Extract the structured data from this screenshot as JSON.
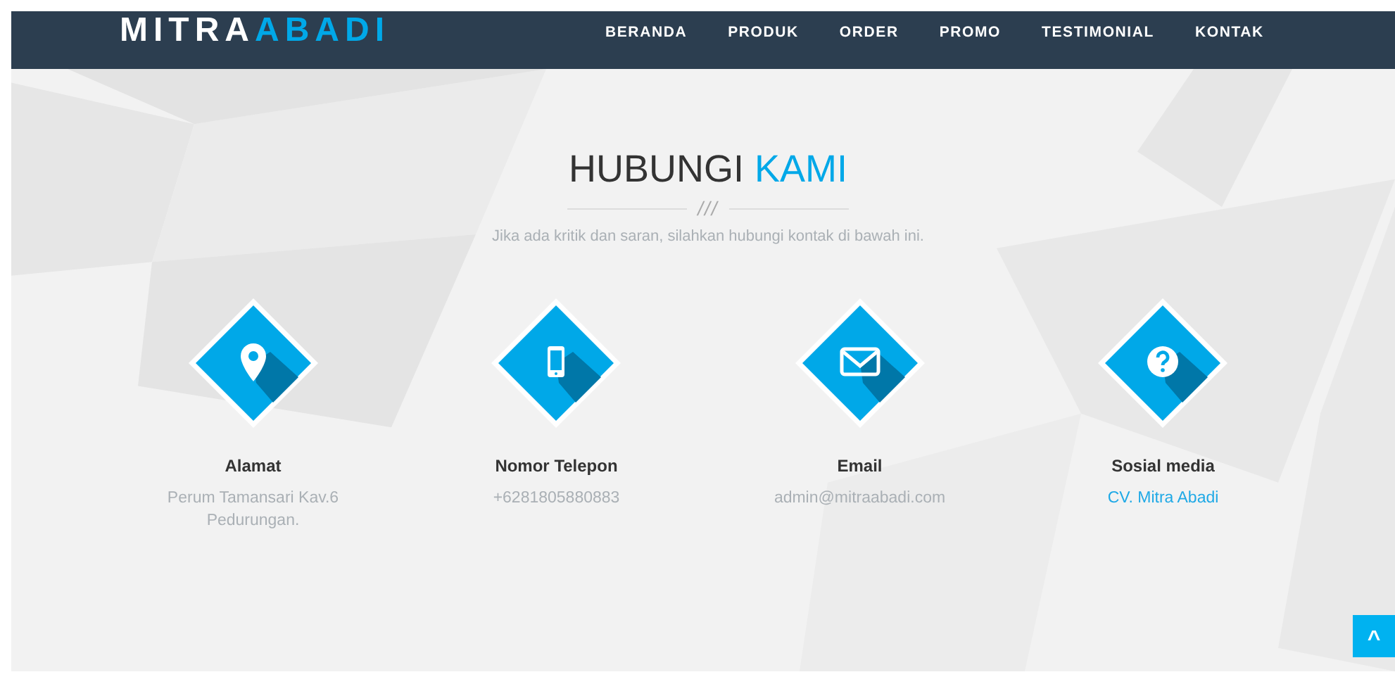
{
  "header": {
    "logo": {
      "text": "MITRA",
      "highlight": "ABADI"
    },
    "nav": [
      {
        "label": "BERANDA"
      },
      {
        "label": "PRODUK"
      },
      {
        "label": "ORDER"
      },
      {
        "label": "PROMO"
      },
      {
        "label": "TESTIMONIAL"
      },
      {
        "label": "KONTAK"
      }
    ]
  },
  "section": {
    "title": "HUBUNGI",
    "title_highlight": "KAMI",
    "divider": "///",
    "subtitle": "Jika ada kritik dan saran, silahkan hubungi kontak di bawah ini.",
    "contacts": [
      {
        "kind": "address",
        "label": "Alamat",
        "value": "Perum Tamansari Kav.6 Pedurungan."
      },
      {
        "kind": "phone",
        "label": "Nomor Telepon",
        "value": "+6281805880883"
      },
      {
        "kind": "email",
        "label": "Email",
        "value": "admin@mitraabadi.com"
      },
      {
        "kind": "social",
        "label": "Sosial media",
        "value": "CV. Mitra Abadi"
      }
    ]
  },
  "scroll_top": {
    "icon": "^"
  }
}
